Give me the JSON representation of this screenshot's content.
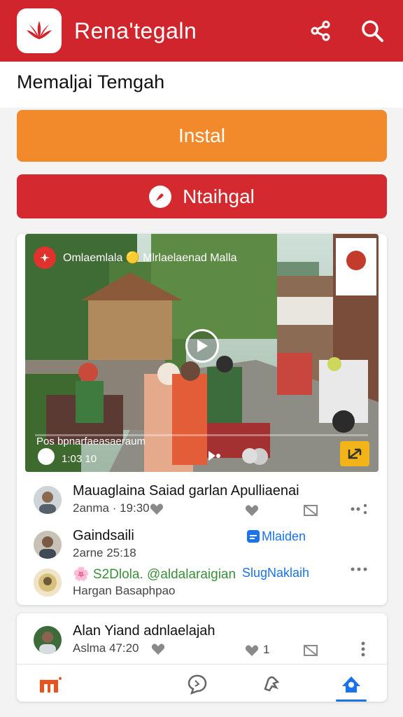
{
  "app": {
    "title": "Rena'tegaln",
    "subtitle": "Memaljai Temgah",
    "brand_color": "#d0252c"
  },
  "buttons": {
    "install": "Instal",
    "secondary": "Ntaihgal"
  },
  "video": {
    "channel": "Omlaemlala 🟡 Mlrlaelaenad Malla",
    "caption": "Pos bpnarfaeasaeraum",
    "time": "1:03 10",
    "progress": 0.0
  },
  "rows": [
    {
      "title": "Mauaglaina Saiad garlan Apulliaenai",
      "subtitle": "2anma · 19:30"
    },
    {
      "title": "Gaindsaili",
      "subtitle": "2arne 25:18",
      "link": "Mlaiden"
    },
    {
      "title": "🌸 S2Dlola. @aldalaraigian",
      "subtitle": "Hargan Basaphpao",
      "link": "SlugNaklaih"
    }
  ],
  "card2": {
    "title": "Alan Yiand adnlaelajah",
    "subtitle": "Aslma 47:20",
    "like_count": "1"
  },
  "icons": {
    "share": "share-icon",
    "search": "search-icon",
    "home": "home-icon",
    "chat": "chat-icon",
    "notifications": "bell-icon",
    "profile": "profile-icon"
  }
}
